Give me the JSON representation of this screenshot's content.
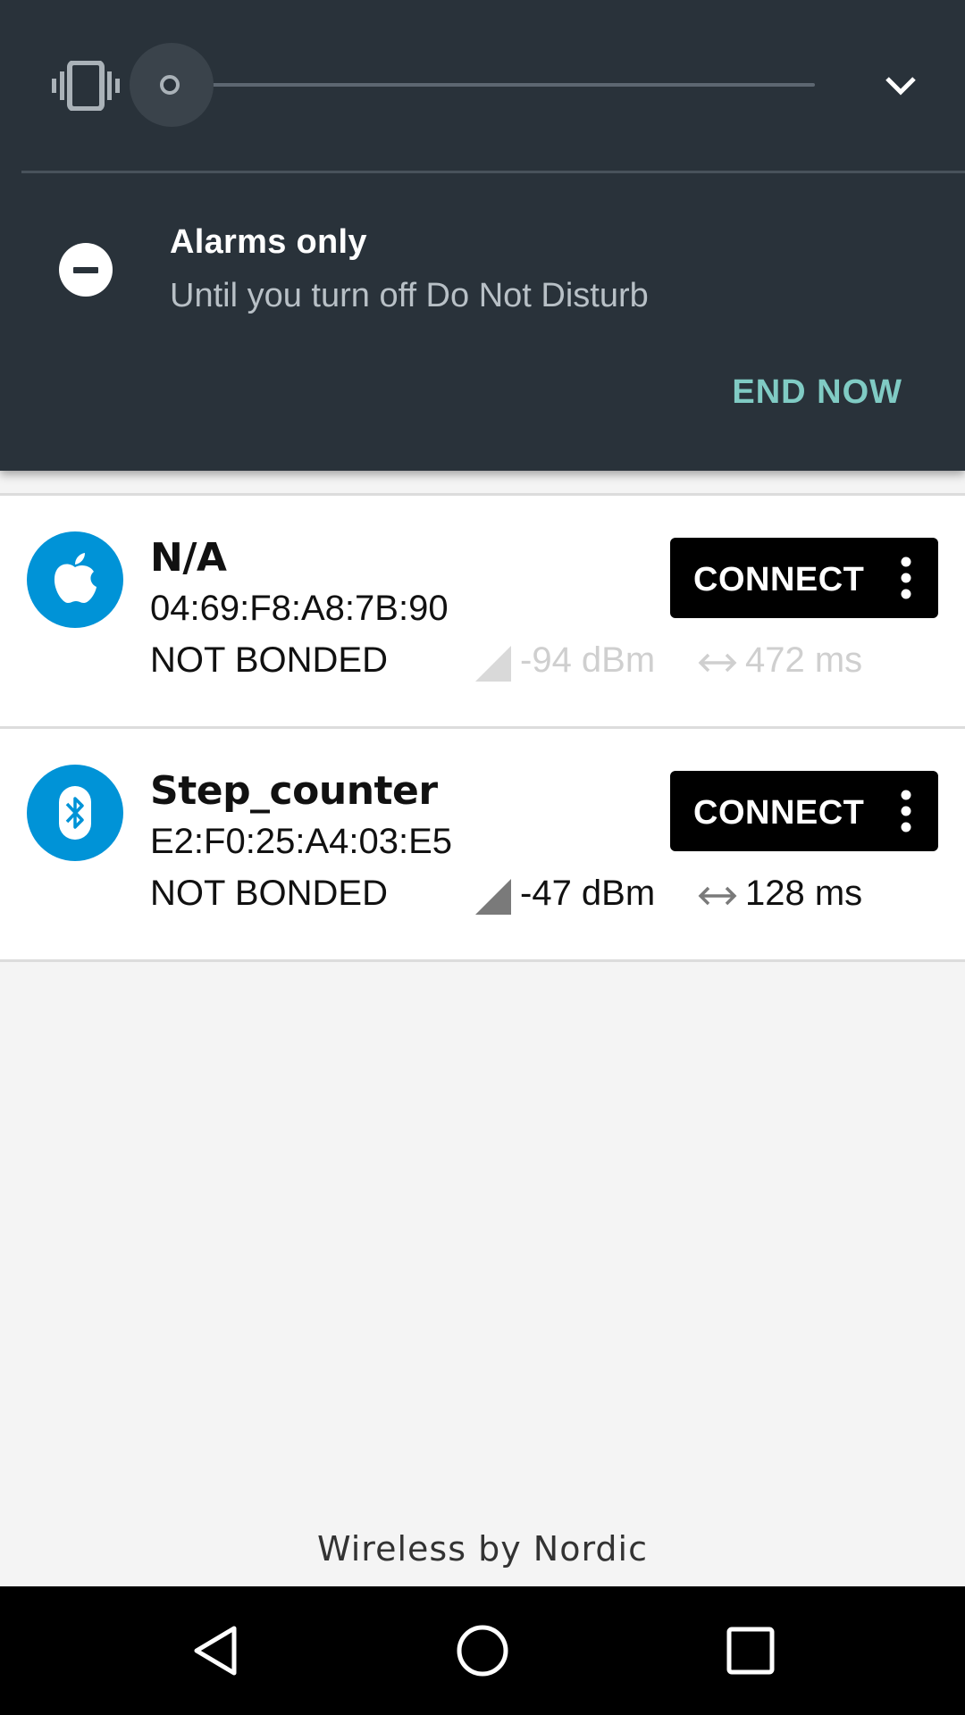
{
  "volume_panel": {
    "mode_icon": "vibrate-icon",
    "collapse_icon": "chevron-down-icon",
    "level": 0
  },
  "dnd": {
    "icon": "do-not-disturb-icon",
    "title": "Alarms only",
    "subtitle": "Until you turn off Do Not Disturb",
    "action_label": "END NOW",
    "action_color": "#80cbc4"
  },
  "devices": [
    {
      "name": "N/A",
      "address": "04:69:F8:A8:7B:90",
      "bond_state": "NOT BONDED",
      "rssi": "-94 dBm",
      "interval": "472 ms",
      "icon": "apple-icon",
      "connect_label": "CONNECT",
      "faded": true
    },
    {
      "name": "Step_counter",
      "address": "E2:F0:25:A4:03:E5",
      "bond_state": "NOT BONDED",
      "rssi": "-47 dBm",
      "interval": "128 ms",
      "icon": "bluetooth-icon",
      "connect_label": "CONNECT",
      "faded": false
    }
  ],
  "footer": {
    "brand": "Wireless by Nordic"
  },
  "colors": {
    "shade_bg": "#29323a",
    "device_icon_bg": "#0093d7",
    "connect_bg": "#000000"
  },
  "navbar": {
    "back": "back-icon",
    "home": "home-icon",
    "recents": "recents-icon"
  }
}
